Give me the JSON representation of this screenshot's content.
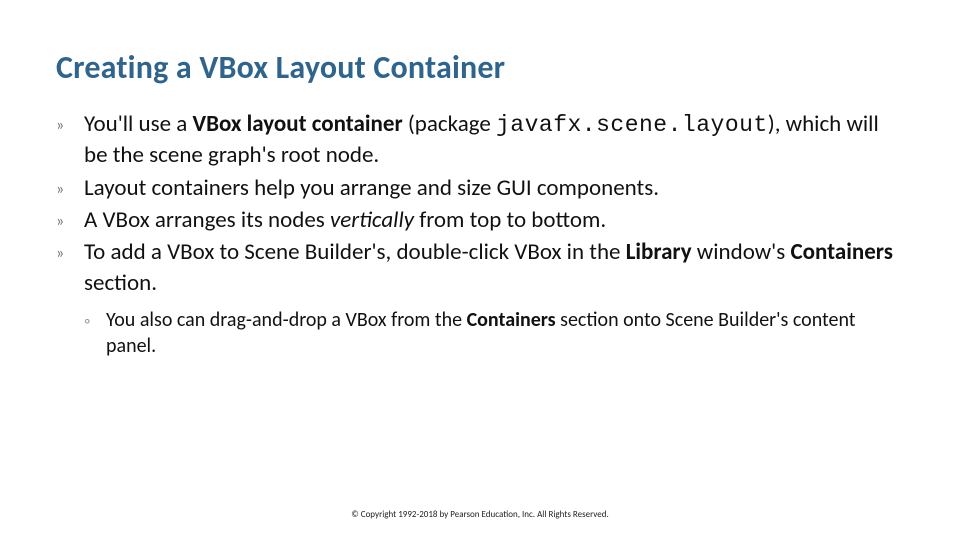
{
  "title": "Creating a VBox Layout Container",
  "bullets": [
    {
      "html": "You'll use a <strong>VBox layout container</strong> (package <span class=\"code\">javafx.scene.layout</span>), which will be the scene graph's root node."
    },
    {
      "html": "Layout containers help you arrange and size GUI components."
    },
    {
      "html": "A VBox arranges its nodes <em>vertically</em> from top to bottom."
    },
    {
      "html": "To add a VBox to Scene Builder's, double-click VBox in the <strong>Library</strong> window's <strong>Containers</strong> section."
    }
  ],
  "sub_bullet": {
    "html": "You also can drag-and-drop a VBox from the <strong>Containers</strong> section onto Scene Builder's content panel."
  },
  "bullet_glyph": "»",
  "sub_glyph": "◦",
  "footer": "© Copyright 1992-2018 by Pearson Education, Inc. All Rights Reserved."
}
